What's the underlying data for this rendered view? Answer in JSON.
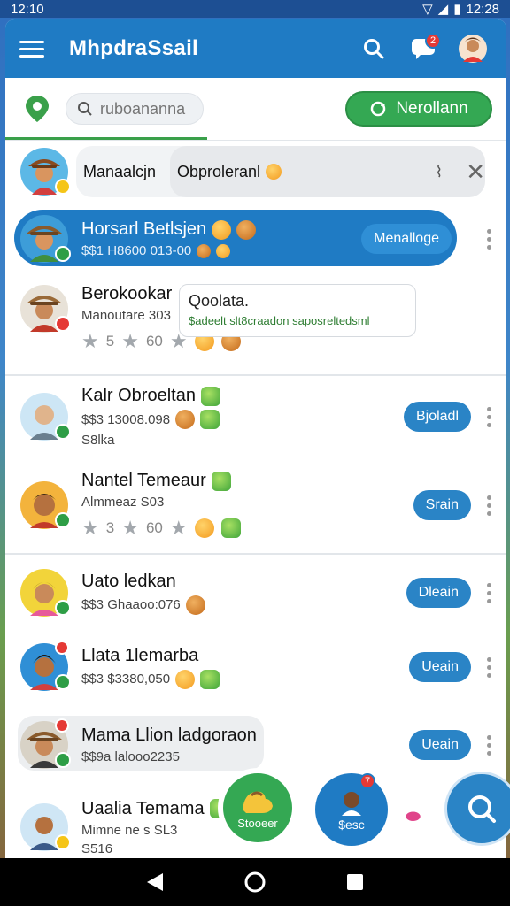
{
  "status": {
    "time": "12:10",
    "time_right": "12:28"
  },
  "header": {
    "title": "MhpdraSsail",
    "notif_count": "2"
  },
  "search": {
    "placeholder": "ruboananna",
    "filter_button": "Nerollann"
  },
  "chat_preview": {
    "name": "Manaalcjn",
    "text": "Obproleranl"
  },
  "contacts": [
    {
      "name": "Horsarl Betlsjen",
      "sub": "$$1 H8600 013-00",
      "action": "Menalloge"
    },
    {
      "name": "Berokookar",
      "sub": "Manoutare 303",
      "rating": "5",
      "rating2": "60",
      "card_title": "Qoolata.",
      "card_sub": "$adeelt slt8craadon saposreltedsml"
    },
    {
      "name": "Kalr Obroeltan",
      "sub": "$$3 13008.098",
      "sub2": "S8lka",
      "action": "Bjoladl"
    },
    {
      "name": "Nantel Temeaur",
      "sub": "Almmeaz S03",
      "rating": "3",
      "rating2": "60",
      "action": "Srain"
    },
    {
      "name": "Uato ledkan",
      "sub": "$$3 Ghaaoo:076",
      "action": "Dleain"
    },
    {
      "name": "Llata 1lemarba",
      "sub": "$$3 $3380,050",
      "action": "Ueain"
    },
    {
      "name": "Mama Llion ladgoraon",
      "sub": "$$9a lalooo2235",
      "action": "Ueain"
    },
    {
      "name": "Uaalia Temama",
      "sub": "Mimne ne s SL3",
      "sub2": "S516"
    }
  ],
  "fabs": {
    "primary": "Stooeer",
    "secondary": "$esc",
    "secondary_badge": "7"
  },
  "colors": {
    "primary": "#1f7bc4",
    "accent": "#34a853",
    "danger": "#e53935"
  }
}
